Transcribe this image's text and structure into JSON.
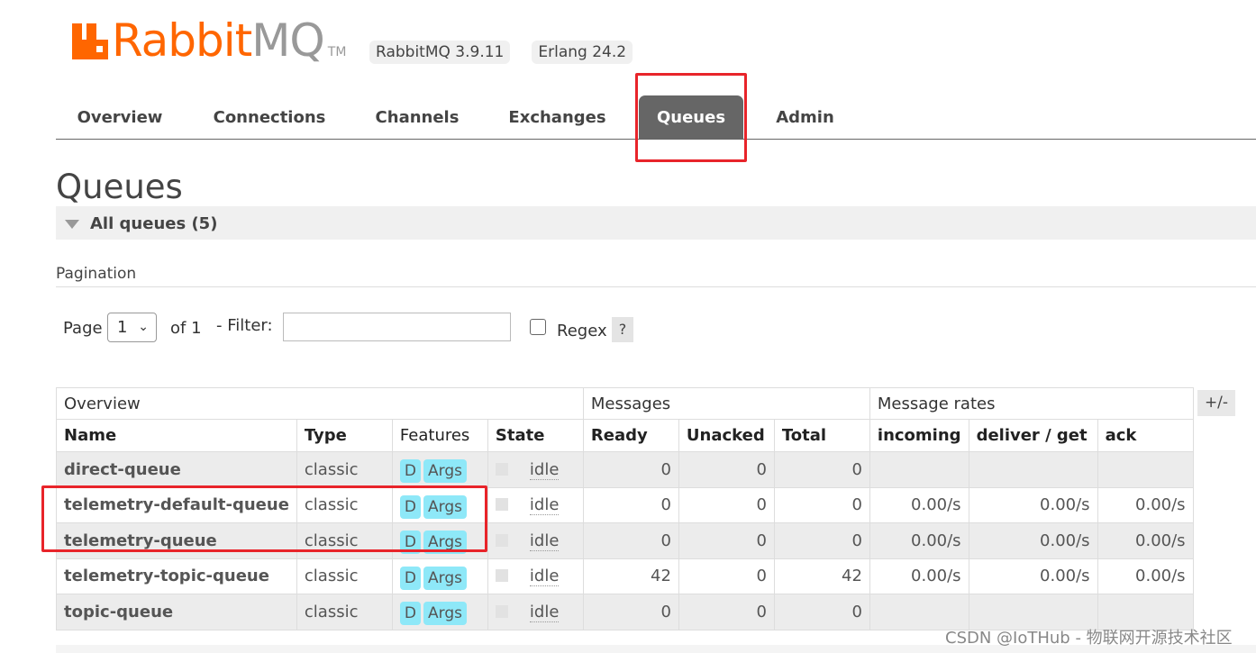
{
  "header": {
    "logo_rabbit": "Rabbit",
    "logo_mq": "MQ",
    "logo_tm": "TM",
    "version_rabbitmq": "RabbitMQ 3.9.11",
    "version_erlang": "Erlang 24.2"
  },
  "tabs": [
    {
      "label": "Overview",
      "active": false
    },
    {
      "label": "Connections",
      "active": false
    },
    {
      "label": "Channels",
      "active": false
    },
    {
      "label": "Exchanges",
      "active": false
    },
    {
      "label": "Queues",
      "active": true
    },
    {
      "label": "Admin",
      "active": false
    }
  ],
  "page": {
    "title": "Queues",
    "section_label": "All queues (5)",
    "pagination_title": "Pagination"
  },
  "pager": {
    "page_label": "Page",
    "page_value": "1",
    "of_label": "of 1",
    "filter_label": "- Filter:",
    "filter_value": "",
    "regex_label": "Regex",
    "regex_checked": false,
    "help_label": "?"
  },
  "table": {
    "groups": {
      "overview": "Overview",
      "messages": "Messages",
      "message_rates": "Message rates"
    },
    "columns": {
      "name": "Name",
      "type": "Type",
      "features": "Features",
      "state": "State",
      "ready": "Ready",
      "unacked": "Unacked",
      "total": "Total",
      "incoming": "incoming",
      "deliver_get": "deliver / get",
      "ack": "ack"
    },
    "plus_minus": "+/-",
    "rows": [
      {
        "name": "direct-queue",
        "type": "classic",
        "feature_d": "D",
        "feature_args": "Args",
        "state": "idle",
        "ready": "0",
        "unacked": "0",
        "total": "0",
        "incoming": "",
        "deliver_get": "",
        "ack": ""
      },
      {
        "name": "telemetry-default-queue",
        "type": "classic",
        "feature_d": "D",
        "feature_args": "Args",
        "state": "idle",
        "ready": "0",
        "unacked": "0",
        "total": "0",
        "incoming": "0.00/s",
        "deliver_get": "0.00/s",
        "ack": "0.00/s"
      },
      {
        "name": "telemetry-queue",
        "type": "classic",
        "feature_d": "D",
        "feature_args": "Args",
        "state": "idle",
        "ready": "0",
        "unacked": "0",
        "total": "0",
        "incoming": "0.00/s",
        "deliver_get": "0.00/s",
        "ack": "0.00/s"
      },
      {
        "name": "telemetry-topic-queue",
        "type": "classic",
        "feature_d": "D",
        "feature_args": "Args",
        "state": "idle",
        "ready": "42",
        "unacked": "0",
        "total": "42",
        "incoming": "0.00/s",
        "deliver_get": "0.00/s",
        "ack": "0.00/s"
      },
      {
        "name": "topic-queue",
        "type": "classic",
        "feature_d": "D",
        "feature_args": "Args",
        "state": "idle",
        "ready": "0",
        "unacked": "0",
        "total": "0",
        "incoming": "",
        "deliver_get": "",
        "ack": ""
      }
    ]
  },
  "watermark": "CSDN @IoTHub - 物联网开源技术社区",
  "colors": {
    "brand_orange": "#ff6600",
    "tab_active_bg": "#666666",
    "feature_badge": "#8ee8f8",
    "highlight_red": "#e8242a"
  }
}
